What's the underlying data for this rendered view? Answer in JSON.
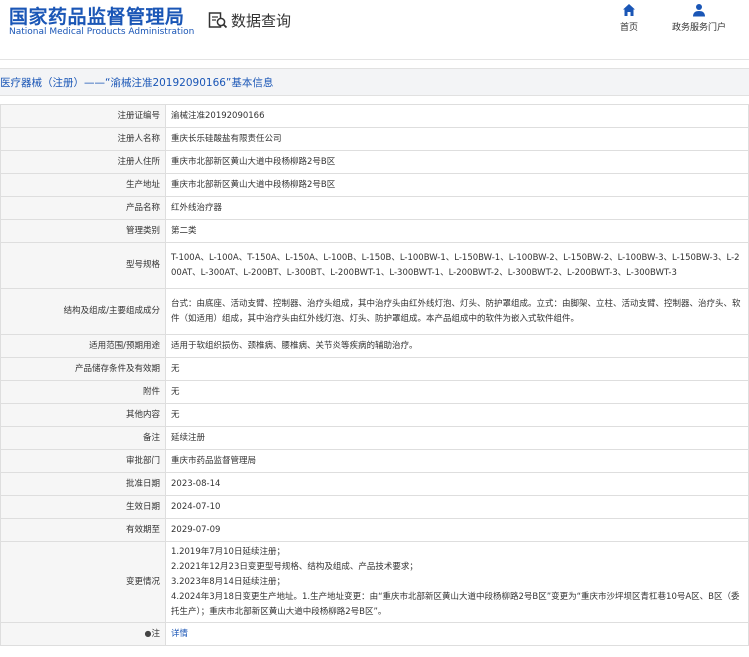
{
  "header": {
    "logo_cn": "国家药品监督管理局",
    "logo_en": "National Medical Products Administration",
    "data_query": "数据查询",
    "nav": [
      {
        "label": "首页",
        "icon": "home-icon"
      },
      {
        "label": "政务服务门户",
        "icon": "user-icon"
      }
    ]
  },
  "page_title": "医疗器械（注册）——“渝械注准20192090166”基本信息",
  "rows": [
    {
      "key": "注册证编号",
      "value": "渝械注准20192090166"
    },
    {
      "key": "注册人名称",
      "value": "重庆长乐硅酸盐有限责任公司"
    },
    {
      "key": "注册人住所",
      "value": "重庆市北部新区黄山大道中段杨柳路2号B区"
    },
    {
      "key": "生产地址",
      "value": "重庆市北部新区黄山大道中段杨柳路2号B区"
    },
    {
      "key": "产品名称",
      "value": "红外线治疗器"
    },
    {
      "key": "管理类别",
      "value": "第二类"
    },
    {
      "key": "型号规格",
      "value": "T-100A、L-100A、T-150A、L-150A、L-100B、L-150B、L-100BW-1、L-150BW-1、L-100BW-2、L-150BW-2、L-100BW-3、L-150BW-3、L-200AT、L-300AT、L-200BT、L-300BT、L-200BWT-1、L-300BWT-1、L-200BWT-2、L-300BWT-2、L-200BWT-3、L-300BWT-3"
    },
    {
      "key": "结构及组成/主要组成成分",
      "value": "台式：由底座、活动支臂、控制器、治疗头组成，其中治疗头由红外线灯泡、灯头、防护罩组成。立式：由脚架、立柱、活动支臂、控制器、治疗头、软件（如适用）组成，其中治疗头由红外线灯泡、灯头、防护罩组成。本产品组成中的软件为嵌入式软件组件。"
    },
    {
      "key": "适用范围/预期用途",
      "value": "适用于软组织损伤、颈椎病、腰椎病、关节炎等疾病的辅助治疗。"
    },
    {
      "key": "产品储存条件及有效期",
      "value": "无"
    },
    {
      "key": "附件",
      "value": "无"
    },
    {
      "key": "其他内容",
      "value": "无"
    },
    {
      "key": "备注",
      "value": "延续注册"
    },
    {
      "key": "审批部门",
      "value": "重庆市药品监督管理局"
    },
    {
      "key": "批准日期",
      "value": "2023-08-14"
    },
    {
      "key": "生效日期",
      "value": "2024-07-10"
    },
    {
      "key": "有效期至",
      "value": "2029-07-09"
    },
    {
      "key": "变更情况",
      "lines": [
        "1.2019年7月10日延续注册；",
        "2.2021年12月23日变更型号规格、结构及组成、产品技术要求；",
        "3.2023年8月14日延续注册；",
        "4.2024年3月18日变更生产地址。1.生产地址变更：由“重庆市北部新区黄山大道中段杨柳路2号B区”变更为“重庆市沙坪坝区青杠巷10号A区、B区（委托生产）；重庆市北部新区黄山大道中段杨柳路2号B区”。"
      ]
    },
    {
      "key": "注",
      "value": "详情"
    }
  ],
  "colors": {
    "brand_blue": "#1a56b6",
    "key_bg": "#f6f6f6",
    "border": "#dedede"
  }
}
